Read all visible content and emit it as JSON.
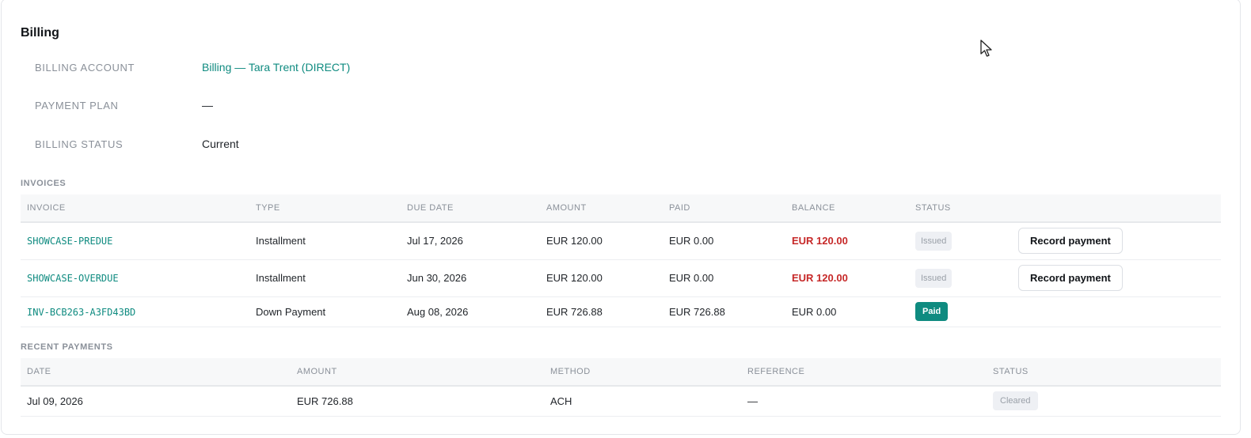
{
  "billing": {
    "title": "Billing",
    "fields": [
      {
        "label": "BILLING ACCOUNT",
        "value": "Billing — Tara Trent (DIRECT)"
      },
      {
        "label": "PAYMENT PLAN",
        "value": "—"
      },
      {
        "label": "BILLING STATUS",
        "value": "Current"
      }
    ]
  },
  "invoices": {
    "title": "INVOICES",
    "headers": [
      "INVOICE",
      "TYPE",
      "DUE DATE",
      "AMOUNT",
      "PAID",
      "BALANCE",
      "STATUS"
    ],
    "rows": [
      {
        "invoice": "SHOWCASE-PREDUE",
        "type": "Installment",
        "due_date": "Jul 17, 2026",
        "amount": "EUR 120.00",
        "paid": "EUR 0.00",
        "balance": "EUR 120.00",
        "status": "Issued",
        "action": "Record payment"
      },
      {
        "invoice": "SHOWCASE-OVERDUE",
        "type": "Installment",
        "due_date": "Jun 30, 2026",
        "amount": "EUR 120.00",
        "paid": "EUR 0.00",
        "balance": "EUR 120.00",
        "status": "Issued",
        "action": "Record payment"
      },
      {
        "invoice": "INV-BCB263-A3FD43BD",
        "type": "Down Payment",
        "due_date": "Aug 08, 2026",
        "amount": "EUR 726.88",
        "paid": "EUR 726.88",
        "balance": "EUR 0.00",
        "status": "Paid"
      }
    ]
  },
  "payments": {
    "title": "RECENT PAYMENTS",
    "headers": [
      "DATE",
      "AMOUNT",
      "METHOD",
      "REFERENCE",
      "STATUS"
    ],
    "rows": [
      {
        "date": "Jul 09, 2026",
        "amount": "EUR 726.88",
        "method": "ACH",
        "reference": "—",
        "status": "Cleared"
      }
    ]
  },
  "colors": {
    "accent": "#0f8b80",
    "balance_due": "#c62828",
    "muted": "#8a9099"
  },
  "icons": {
    "cursor": "mouse-pointer-icon"
  }
}
